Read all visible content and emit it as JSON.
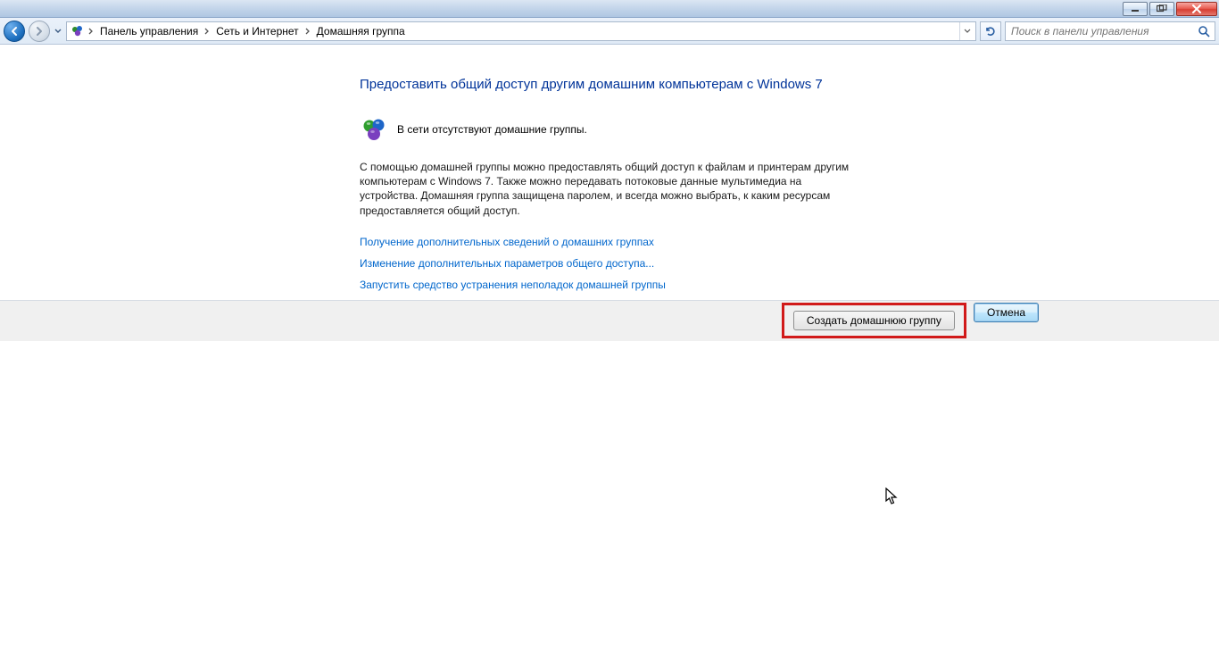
{
  "breadcrumb": {
    "items": [
      "Панель управления",
      "Сеть и Интернет",
      "Домашняя группа"
    ]
  },
  "search": {
    "placeholder": "Поиск в панели управления"
  },
  "main": {
    "heading": "Предоставить общий доступ другим домашним компьютерам с Windows 7",
    "status": "В сети отсутствуют домашние группы.",
    "description": "С помощью домашней группы можно предоставлять общий доступ к файлам и принтерам другим компьютерам с Windows 7. Также можно передавать потоковые данные мультимедиа на устройства. Домашняя группа защищена паролем, и всегда можно выбрать, к каким ресурсам предоставляется общий доступ.",
    "links": {
      "learn_more": "Получение дополнительных сведений о домашних группах",
      "advanced": "Изменение дополнительных параметров общего доступа...",
      "troubleshoot": "Запустить средство устранения неполадок домашней группы"
    }
  },
  "buttons": {
    "create": "Создать домашнюю группу",
    "cancel": "Отмена"
  }
}
